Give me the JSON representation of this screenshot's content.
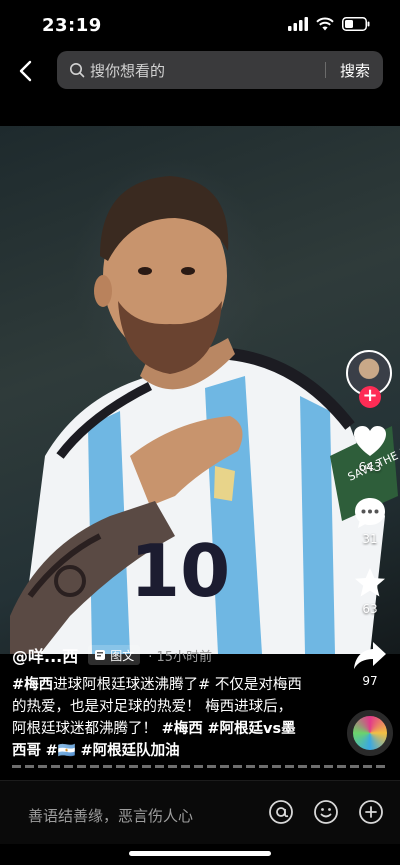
{
  "status_bar": {
    "time": "23:19",
    "icons": [
      "signal-icon",
      "wifi-icon",
      "battery-icon"
    ]
  },
  "search": {
    "back_icon": "back-arrow-icon",
    "placeholder": "搜你想看的",
    "submit_label": "搜索"
  },
  "video": {
    "jersey_number": "10",
    "armband_text": "SAVE THE PLANET"
  },
  "actions": {
    "like_count": "643",
    "comment_count": "31",
    "favorite_count": "63",
    "share_count": "97",
    "follow_symbol": "+"
  },
  "post": {
    "author": "@咩...西",
    "type_tag": "图文",
    "time_ago": "· 15小时前",
    "caption_parts": [
      {
        "text": "#梅西",
        "hashtag": true
      },
      {
        "text": "进球阿根廷球迷沸腾了# 不仅是对梅西的热爱，也是对足球的热爱！ 梅西进球后，阿根廷球迷都沸腾了！ ",
        "hashtag": false
      },
      {
        "text": "#梅西",
        "hashtag": true
      },
      {
        "text": " ",
        "hashtag": false
      },
      {
        "text": "#阿根廷vs墨西哥",
        "hashtag": true
      },
      {
        "text": " ",
        "hashtag": false
      },
      {
        "text": "#🇦🇷",
        "hashtag": true
      },
      {
        "text": " ",
        "hashtag": false
      },
      {
        "text": "#阿根廷队加油",
        "hashtag": true
      }
    ]
  },
  "comment_bar": {
    "placeholder": "善语结善缘，恶言伤人心",
    "icons": [
      "at-icon",
      "emoji-icon",
      "add-icon"
    ]
  },
  "colors": {
    "accent_red": "#fe2c55",
    "search_bg": "#3a3a3c",
    "background": "#000000"
  }
}
